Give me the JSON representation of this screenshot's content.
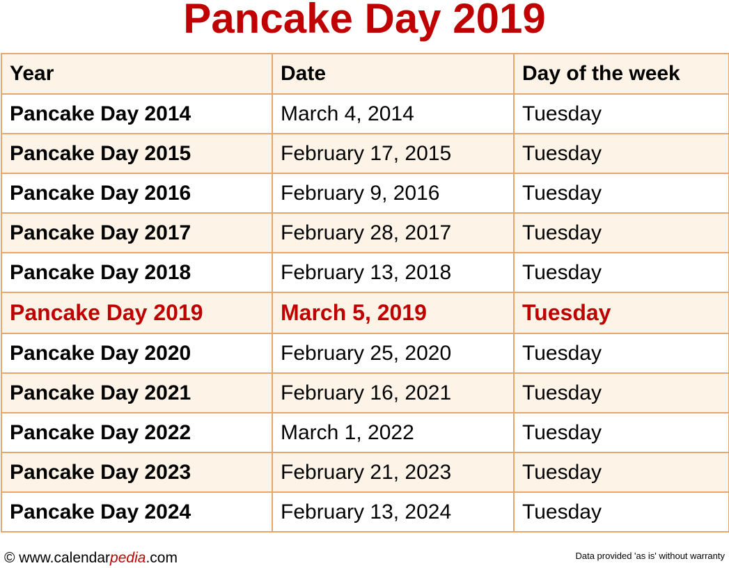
{
  "title": "Pancake Day 2019",
  "table": {
    "headers": [
      "Year",
      "Date",
      "Day of the week"
    ],
    "rows": [
      {
        "year": "Pancake Day 2014",
        "date": "March 4, 2014",
        "weekday": "Tuesday"
      },
      {
        "year": "Pancake Day 2015",
        "date": "February 17, 2015",
        "weekday": "Tuesday"
      },
      {
        "year": "Pancake Day 2016",
        "date": "February 9, 2016",
        "weekday": "Tuesday"
      },
      {
        "year": "Pancake Day 2017",
        "date": "February 28, 2017",
        "weekday": "Tuesday"
      },
      {
        "year": "Pancake Day 2018",
        "date": "February 13, 2018",
        "weekday": "Tuesday"
      },
      {
        "year": "Pancake Day 2019",
        "date": "March 5, 2019",
        "weekday": "Tuesday",
        "highlighted": true
      },
      {
        "year": "Pancake Day 2020",
        "date": "February 25, 2020",
        "weekday": "Tuesday"
      },
      {
        "year": "Pancake Day 2021",
        "date": "February 16, 2021",
        "weekday": "Tuesday"
      },
      {
        "year": "Pancake Day 2022",
        "date": "March 1, 2022",
        "weekday": "Tuesday"
      },
      {
        "year": "Pancake Day 2023",
        "date": "February 21, 2023",
        "weekday": "Tuesday"
      },
      {
        "year": "Pancake Day 2024",
        "date": "February 13, 2024",
        "weekday": "Tuesday"
      }
    ]
  },
  "footer": {
    "copyright_prefix": "© www.calendar",
    "brand": "pedia",
    "suffix": ".com",
    "disclaimer": "Data provided 'as is' without warranty"
  },
  "colors": {
    "accent": "#c00000",
    "border": "#e8a668",
    "row_tint": "#fdf3e6"
  }
}
